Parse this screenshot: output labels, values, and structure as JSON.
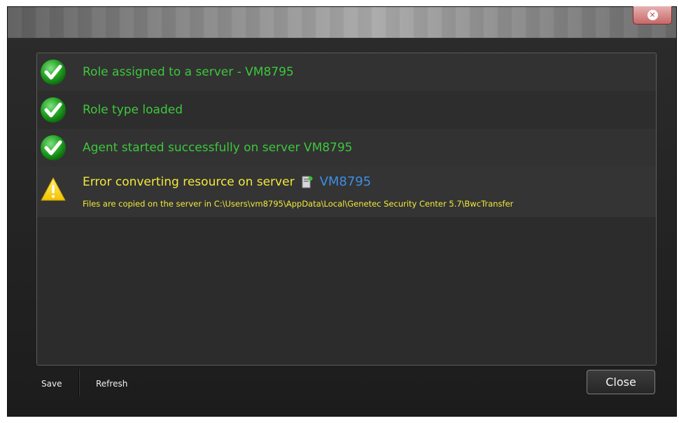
{
  "window": {
    "close_glyph": "✕"
  },
  "log": {
    "items": [
      {
        "status": "success",
        "icon": "check-icon",
        "text": "Role assigned to a server - VM8795"
      },
      {
        "status": "success",
        "icon": "check-icon",
        "text": "Role type loaded"
      },
      {
        "status": "success",
        "icon": "check-icon",
        "text": "Agent started successfully on server VM8795"
      }
    ],
    "warning": {
      "icon": "warning-icon",
      "title": "Error converting resource on server",
      "server_icon": "server-icon",
      "server_name": "VM8795",
      "detail": "Files are copied on the server in C:\\Users\\vm8795\\AppData\\Local\\Genetec Security Center 5.7\\BwcTransfer"
    }
  },
  "footer": {
    "save_label": "Save",
    "refresh_label": "Refresh",
    "close_label": "Close"
  },
  "colors": {
    "success_text": "#3cc83c",
    "warning_text": "#f2ea3a",
    "link": "#3d8ee6"
  }
}
